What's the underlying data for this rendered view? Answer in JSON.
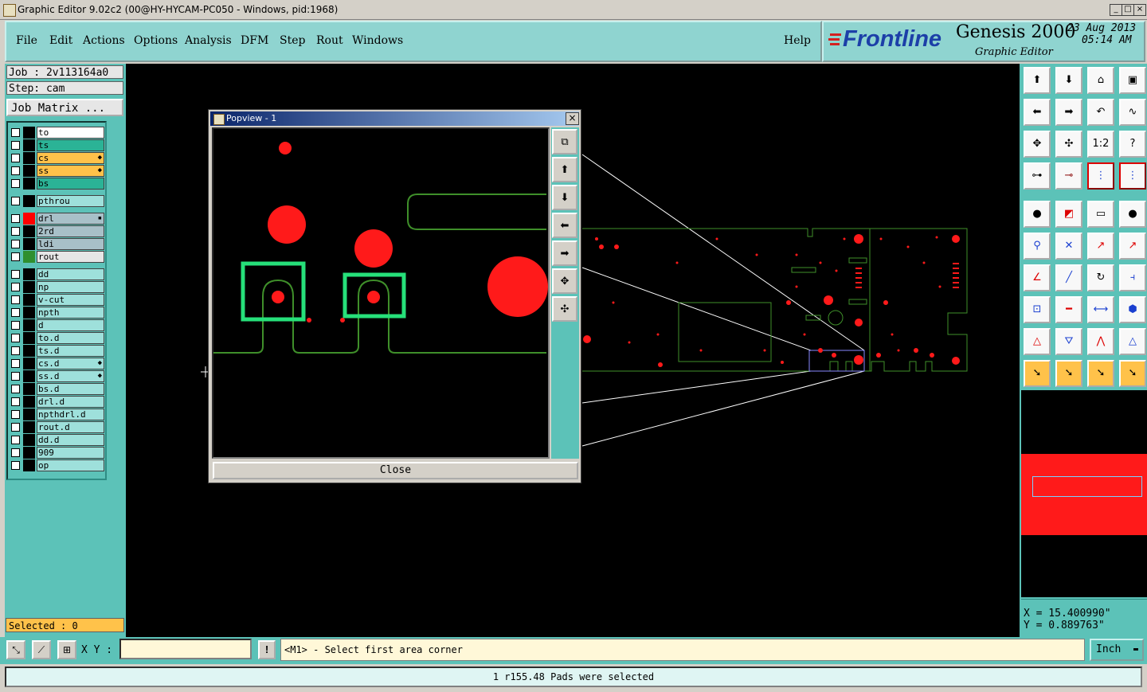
{
  "window": {
    "title": "Graphic Editor 9.02c2 (00@HY-HYCAM-PC050 - Windows, pid:1968)",
    "controls": [
      "_",
      "□",
      "×"
    ]
  },
  "menu": {
    "items": [
      "File",
      "Edit",
      "Actions",
      "Options",
      "Analysis",
      "DFM",
      "Step",
      "Rout",
      "Windows"
    ],
    "help": "Help"
  },
  "brand": {
    "logo": "Frontline",
    "product": "Genesis 2000",
    "subtitle": "Graphic Editor",
    "date": "23 Aug 2013",
    "time": "05:14 AM"
  },
  "job": {
    "job_label": "Job : 2v113164a0",
    "step_label": "Step: cam",
    "matrix_button": "Job Matrix ..."
  },
  "layers": [
    {
      "name": "to",
      "color": "#ffffff",
      "swatch": "#000000",
      "mark": ""
    },
    {
      "name": "ts",
      "color": "#2bb396",
      "swatch": "#000000",
      "mark": ""
    },
    {
      "name": "cs",
      "color": "#ffc24a",
      "swatch": "#000000",
      "mark": "◆"
    },
    {
      "name": "ss",
      "color": "#ffc24a",
      "swatch": "#000000",
      "mark": "◆"
    },
    {
      "name": "bs",
      "color": "#2bb396",
      "swatch": "#000000",
      "mark": ""
    },
    {
      "name": "pthrou",
      "color": "#9ee0db",
      "swatch": "#000000",
      "mark": ""
    },
    {
      "name": "drl",
      "color": "#a8c0c8",
      "swatch": "#ff0000",
      "mark": "▪"
    },
    {
      "name": "2rd",
      "color": "#a8c0c8",
      "swatch": "#000000",
      "mark": ""
    },
    {
      "name": "ldi",
      "color": "#a8c0c8",
      "swatch": "#000000",
      "mark": ""
    },
    {
      "name": "rout",
      "color": "#e6e6e6",
      "swatch": "#2f8f2f",
      "mark": ""
    },
    {
      "name": "dd",
      "color": "#9ee0db",
      "swatch": "#000000",
      "mark": ""
    },
    {
      "name": "np",
      "color": "#9ee0db",
      "swatch": "#000000",
      "mark": ""
    },
    {
      "name": "v-cut",
      "color": "#9ee0db",
      "swatch": "#000000",
      "mark": ""
    },
    {
      "name": "npth",
      "color": "#9ee0db",
      "swatch": "#000000",
      "mark": ""
    },
    {
      "name": "d",
      "color": "#9ee0db",
      "swatch": "#000000",
      "mark": ""
    },
    {
      "name": "to.d",
      "color": "#9ee0db",
      "swatch": "#000000",
      "mark": ""
    },
    {
      "name": "ts.d",
      "color": "#9ee0db",
      "swatch": "#000000",
      "mark": ""
    },
    {
      "name": "cs.d",
      "color": "#9ee0db",
      "swatch": "#000000",
      "mark": "◆"
    },
    {
      "name": "ss.d",
      "color": "#9ee0db",
      "swatch": "#000000",
      "mark": "◆"
    },
    {
      "name": "bs.d",
      "color": "#9ee0db",
      "swatch": "#000000",
      "mark": ""
    },
    {
      "name": "drl.d",
      "color": "#9ee0db",
      "swatch": "#000000",
      "mark": ""
    },
    {
      "name": "npthdrl.d",
      "color": "#9ee0db",
      "swatch": "#000000",
      "mark": ""
    },
    {
      "name": "rout.d",
      "color": "#9ee0db",
      "swatch": "#000000",
      "mark": ""
    },
    {
      "name": "dd.d",
      "color": "#9ee0db",
      "swatch": "#000000",
      "mark": ""
    },
    {
      "name": "909",
      "color": "#9ee0db",
      "swatch": "#000000",
      "mark": ""
    },
    {
      "name": "op",
      "color": "#9ee0db",
      "swatch": "#000000",
      "mark": ""
    }
  ],
  "selected": "Selected : 0",
  "popview": {
    "title": "Popview - 1",
    "close_button": "Close",
    "close_icon": "×"
  },
  "coords": {
    "x": "X = 15.400990\"",
    "y": "Y = 0.889763\""
  },
  "command": {
    "xy_label": "X Y :",
    "xy_value": "",
    "bang": "!",
    "prompt": "<M1> - Select first area corner",
    "units": "Inch"
  },
  "status": "1 r155.48 Pads were selected",
  "toolbar_icons": [
    "zoom-home-icon",
    "zoom-prev-icon",
    "home-icon",
    "window-icon",
    "pan-left-icon",
    "pan-right-icon",
    "undo-zoom-icon",
    "snap-icon",
    "zoom-fit-icon",
    "zoom-center-icon",
    "scale-1-2-icon",
    "help-icon",
    "measure-icon",
    "probe-icon",
    "layer-net-icon",
    "layer-net-red-icon",
    "pad-select-icon",
    "color-icon",
    "ruler-icon",
    "circle-icon",
    "connect-icon",
    "cross-icon",
    "line-red-icon",
    "line-dot-icon",
    "angle-icon",
    "slash-icon",
    "arc-icon",
    "split-icon",
    "pad-rect-icon",
    "hline-icon",
    "dim-icon",
    "shapes-icon",
    "triangle-icon",
    "triangle-blue-icon",
    "triangle-up-icon",
    "triangle-right-icon",
    "select-arrow-icon",
    "select-box-icon",
    "select-cursor-icon",
    "step-arrow-icon"
  ]
}
